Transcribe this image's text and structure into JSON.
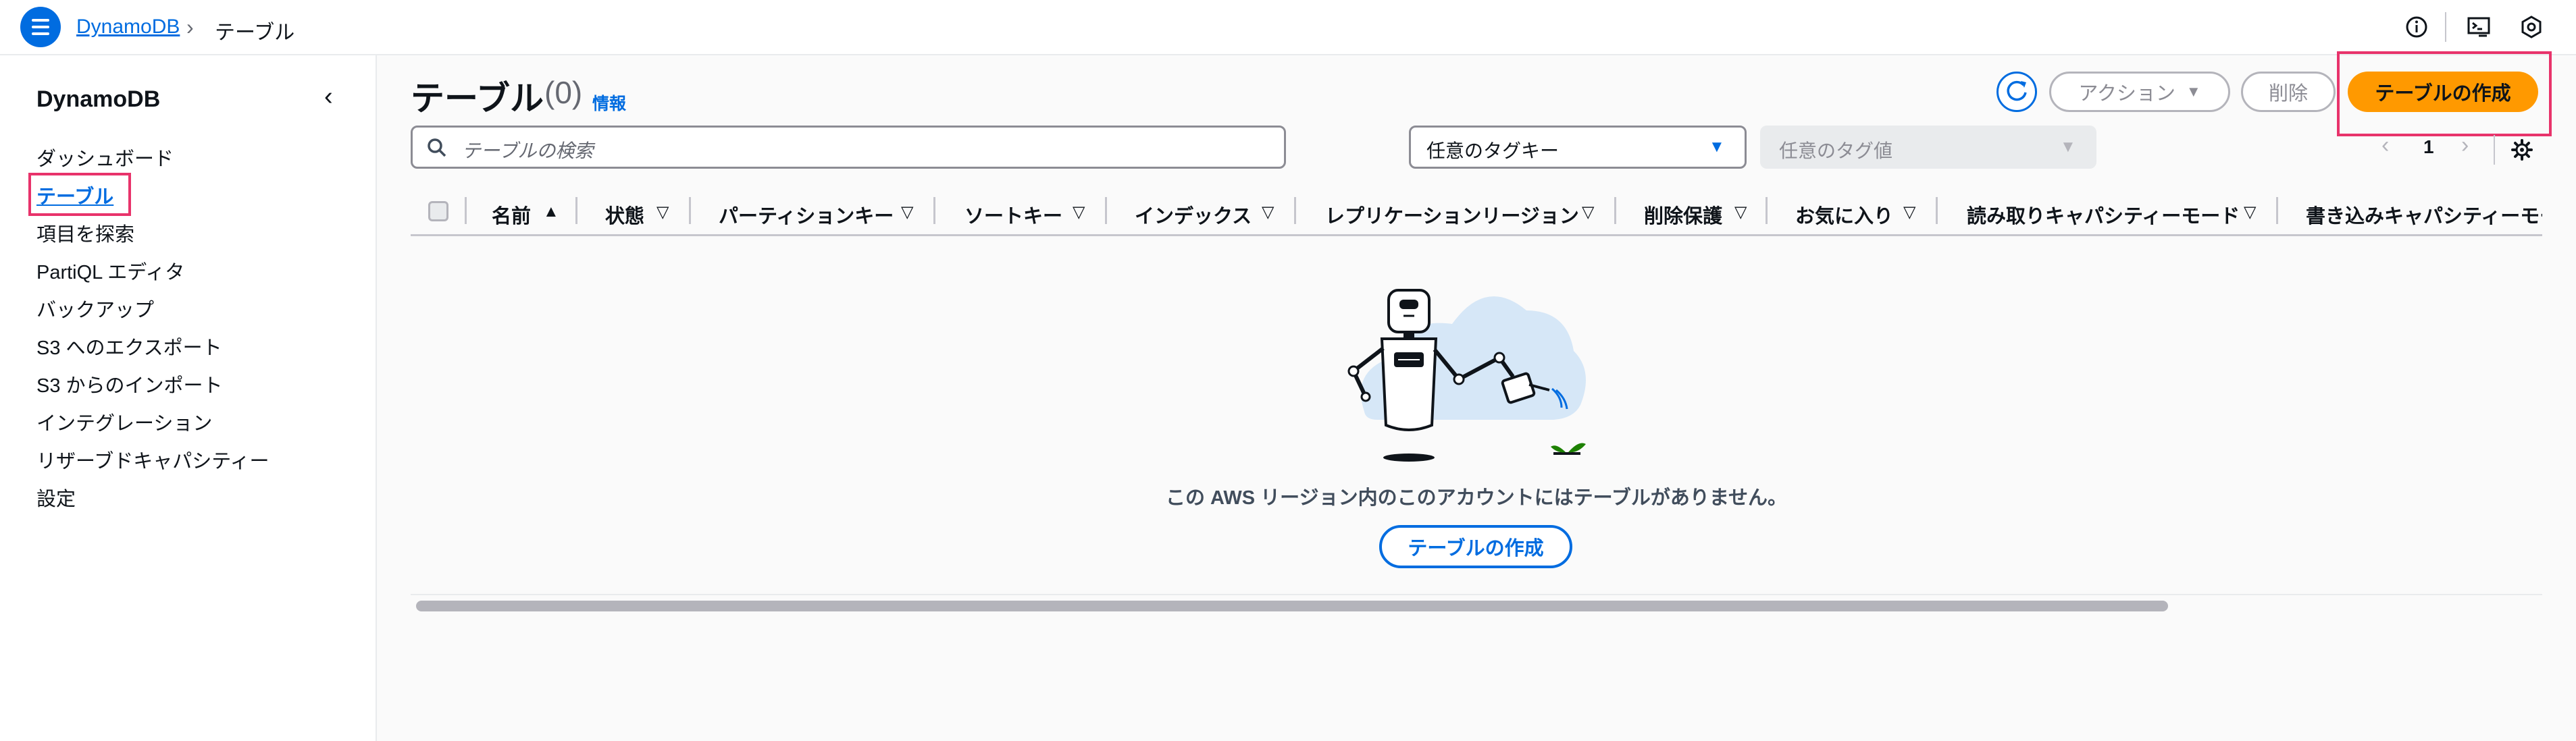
{
  "breadcrumb": {
    "home": "DynamoDB",
    "separator": "›",
    "current": "テーブル"
  },
  "sidebar": {
    "title": "DynamoDB",
    "items": [
      {
        "label": "ダッシュボード"
      },
      {
        "label": "テーブル"
      },
      {
        "label": "項目を探索"
      },
      {
        "label": "PartiQL エディタ"
      },
      {
        "label": "バックアップ"
      },
      {
        "label": "S3 へのエクスポート"
      },
      {
        "label": "S3 からのインポート"
      },
      {
        "label": "インテグレーション"
      },
      {
        "label": "リザーブドキャパシティー"
      },
      {
        "label": "設定"
      }
    ]
  },
  "header": {
    "title": "テーブル",
    "count": "(0)",
    "info": "情報",
    "actions_label": "アクション",
    "delete_label": "削除",
    "create_label": "テーブルの作成"
  },
  "filters": {
    "search_placeholder": "テーブルの検索",
    "tag_key": "任意のタグキー",
    "tag_value": "任意のタグ値"
  },
  "pagination": {
    "page": "1"
  },
  "table": {
    "columns": [
      {
        "label": "名前",
        "sort": "▲"
      },
      {
        "label": "状態",
        "sort": "▽"
      },
      {
        "label": "パーティションキー",
        "sort": "▽"
      },
      {
        "label": "ソートキー",
        "sort": "▽"
      },
      {
        "label": "インデックス",
        "sort": "▽"
      },
      {
        "label": "レプリケーションリージョン",
        "sort": "▽"
      },
      {
        "label": "削除保護",
        "sort": "▽"
      },
      {
        "label": "お気に入り",
        "sort": "▽"
      },
      {
        "label": "読み取りキャパシティーモード",
        "sort": "▽"
      },
      {
        "label": "書き込みキャパシティーモー",
        "sort": ""
      }
    ],
    "empty_message": "この AWS リージョン内のこのアカウントにはテーブルがありません。",
    "empty_create_label": "テーブルの作成"
  },
  "colors": {
    "accent": "#006ce0",
    "primary_button": "#ff9900",
    "highlight": "#e8336b"
  },
  "icons": [
    "menu-icon",
    "info-icon",
    "cloudshell-icon",
    "settings-icon",
    "refresh-icon",
    "search-icon",
    "caret-down-icon",
    "chevron-left-icon",
    "chevron-right-icon",
    "gear-icon"
  ]
}
